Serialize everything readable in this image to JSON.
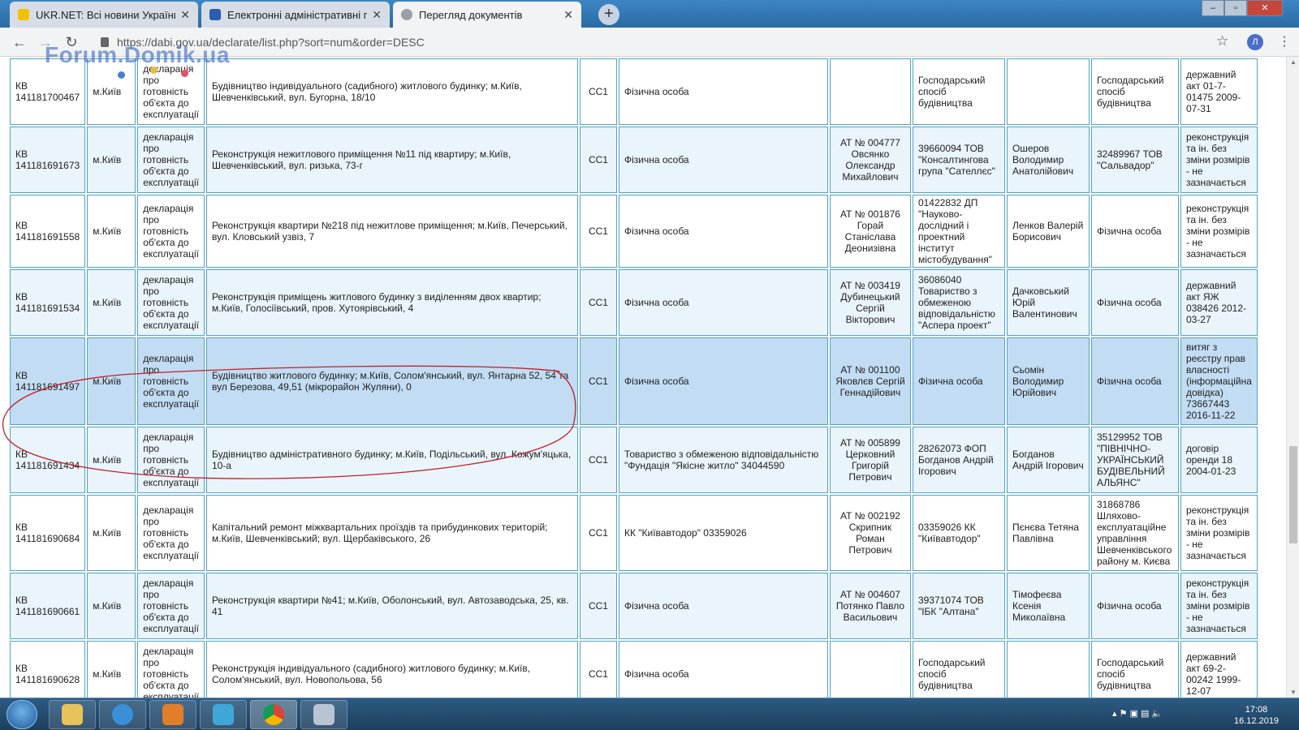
{
  "browser": {
    "tabs": [
      {
        "title": "UKR.NET: Всі новини України, ос",
        "active": false
      },
      {
        "title": "Електронні адміністративні пос",
        "active": false
      },
      {
        "title": "Перегляд документів",
        "active": true
      }
    ],
    "url": "https://dabi.gov.ua/declarate/list.php?sort=num&order=DESC",
    "profile_initial": "Л"
  },
  "watermark": "Forum.Domik.ua",
  "rows": [
    {
      "num": "КВ 141181700467",
      "city": "м.Київ",
      "doc": "декларація про готовність об'єкта до експлуатації",
      "object": "Будівництво індивідуального (садибного) житлового будинку; м.Київ, Шевченківський, вул. Бугорна, 18/10",
      "cls": "СС1",
      "customer": "Фізична особа",
      "author": "",
      "genproj": "Господарський спосіб будівництва",
      "tech": "",
      "contractor": "Господарський спосіб будівництва",
      "landdoc": "державний акт 01-7-01475 2009-07-31"
    },
    {
      "num": "КВ 141181691673",
      "city": "м.Київ",
      "doc": "декларація про готовність об'єкта до експлуатації",
      "object": "Реконструкція нежитлового приміщення №11 під квартиру; м.Київ, Шевченківський, вул. ризька, 73-г",
      "cls": "СС1",
      "customer": "Фізична особа",
      "author": "АТ № 004777 Овсянко Олександр Михайлович",
      "genproj": "39660094 ТОВ \"Консалтингова група \"Сателлєс\"",
      "tech": "Ошеров Володимир Анатолійович",
      "contractor": "32489967 ТОВ \"Сальвадор\"",
      "landdoc": "реконструкція та ін. без зміни розмірів - не зазначається"
    },
    {
      "num": "КВ 141181691558",
      "city": "м.Київ",
      "doc": "декларація про готовність об'єкта до експлуатації",
      "object": "Реконструкція квартири №218 під нежитлове приміщення; м.Київ, Печерський, вул. Кловський узвіз, 7",
      "cls": "СС1",
      "customer": "Фізична особа",
      "author": "АТ № 001876 Горай Станіслава Деонизівна",
      "genproj": "01422832 ДП \"Науково-дослідний і проектний інститут містобудування\"",
      "tech": "Ленков Валерій Борисович",
      "contractor": "Фізична особа",
      "landdoc": "реконструкція та ін. без зміни розмірів - не зазначається"
    },
    {
      "num": "КВ 141181691534",
      "city": "м.Київ",
      "doc": "декларація про готовність об'єкта до експлуатації",
      "object": "Реконструкція приміщень житлового будинку з виділенням двох квартир; м.Київ, Голосіївський, пров. Хутоярівський, 4",
      "cls": "СС1",
      "customer": "Фізична особа",
      "author": "АТ № 003419 Дубинецький Сергій Вікторович",
      "genproj": "36086040 Товариство з обмеженою відповідальністю \"Аспера проект\"",
      "tech": "Дачковський Юрій Валентинович",
      "contractor": "Фізична особа",
      "landdoc": "державний акт ЯЖ 038426 2012-03-27"
    },
    {
      "num": "КВ 141181691497",
      "city": "м.Київ",
      "doc": "декларація про готовність об'єкта до експлуатації",
      "object": "Будівництво житлового будинку; м.Київ, Солом'янський, вул. Янтарна 52, 54 та вул Березова, 49,51 (мікрорайон Жуляни), 0",
      "cls": "СС1",
      "customer": "Фізична особа",
      "author": "АТ № 001100 Яковлєв Сергій Геннадійович",
      "genproj": "Фізична особа",
      "tech": "Сьомін Володимир Юрійович",
      "contractor": "Фізична особа",
      "landdoc": "витяг з реєстру прав власності (інформаційна довідка) 73667443 2016-11-22"
    },
    {
      "num": "КВ 141181691434",
      "city": "м.Київ",
      "doc": "декларація про готовність об'єкта до експлуатації",
      "object": "Будівництво адміністративного будинку; м.Київ, Подільський, вул. Кожум'яцька, 10-а",
      "cls": "СС1",
      "customer": "Товариство з обмеженою відповідальністю \"Фундація \"Якісне житло\" 34044590",
      "author": "АТ № 005899 Церковний Григорій Петрович",
      "genproj": "28262073 ФОП Богданов Андрій Ігорович",
      "tech": "Богданов Андрій Ігорович",
      "contractor": "35129952 ТОВ \"ПІВНІЧНО-УКРАЇНСЬКИЙ БУДІВЕЛЬНИЙ АЛЬЯНС\"",
      "landdoc": "договір оренди 18 2004-01-23"
    },
    {
      "num": "КВ 141181690684",
      "city": "м.Київ",
      "doc": "декларація про готовність об'єкта до експлуатації",
      "object": "Капітальний ремонт міжквартальних проїздів та прибудинкових територій; м.Київ, Шевченківський; вул. Щербаківського, 26",
      "cls": "СС1",
      "customer": "КК \"Київавтодор\" 03359026",
      "author": "АТ № 002192 Скрипник Роман Петрович",
      "genproj": "03359026 КК \"Київавтодор\"",
      "tech": "Пєнєва Тетяна Павлівна",
      "contractor": "31868786 Шляхово-експлуатаційне управління Шевченківського району м. Києва",
      "landdoc": "реконструкція та ін. без зміни розмірів - не зазначається"
    },
    {
      "num": "КВ 141181690661",
      "city": "м.Київ",
      "doc": "декларація про готовність об'єкта до експлуатації",
      "object": "Реконструкція квартири №41; м.Київ, Оболонський, вул. Автозаводська, 25, кв. 41",
      "cls": "СС1",
      "customer": "Фізична особа",
      "author": "АТ № 004607 Потянко Павло Васильович",
      "genproj": "39371074 ТОВ \"ІБК \"Алтана\"",
      "tech": "Тімофеєва Ксенія Миколаївна",
      "contractor": "Фізична особа",
      "landdoc": "реконструкція та ін. без зміни розмірів - не зазначається"
    },
    {
      "num": "КВ 141181690628",
      "city": "м.Київ",
      "doc": "декларація про готовність об'єкта до експлуатації",
      "object": "Реконструкція індивідуального (садибного) житлового будинку; м.Київ, Солом'янський, вул. Новопольова, 56",
      "cls": "СС1",
      "customer": "Фізична особа",
      "author": "",
      "genproj": "Господарський спосіб будівництва",
      "tech": "",
      "contractor": "Господарський спосіб будівництва",
      "landdoc": "державний акт 69-2-00242 1999-12-07"
    }
  ],
  "taskbar": {
    "time": "17:08",
    "date": "16.12.2019"
  },
  "colors": {
    "cell_border": "#4fa3c8",
    "row_alt": "#eaf4fb",
    "row_selected": "#c2dcf3",
    "annotation": "#c0202a"
  }
}
